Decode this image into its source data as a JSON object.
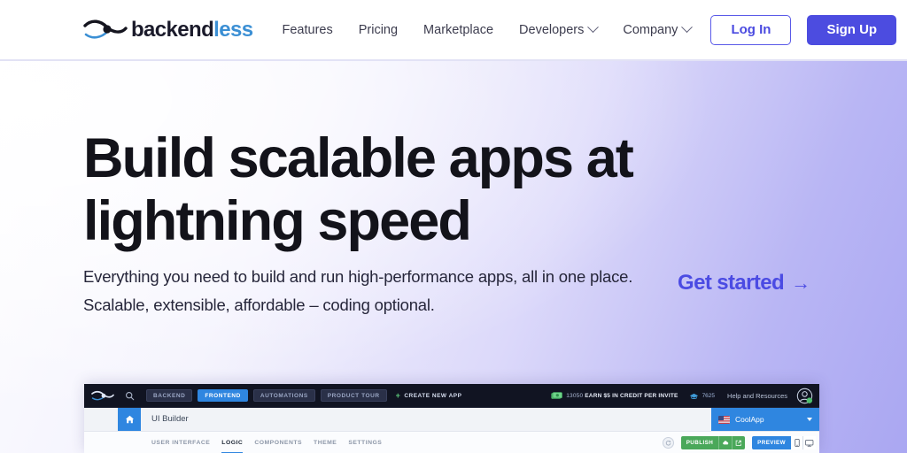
{
  "brand": {
    "name_dark": "backend",
    "name_blue": "less",
    "logo_icon": "backendless-infinity-logo",
    "blue": "#3b8fd4"
  },
  "nav": {
    "items": [
      {
        "label": "Features",
        "has_caret": false
      },
      {
        "label": "Pricing",
        "has_caret": false
      },
      {
        "label": "Marketplace",
        "has_caret": false
      },
      {
        "label": "Developers",
        "has_caret": true
      },
      {
        "label": "Company",
        "has_caret": true
      }
    ],
    "login_label": "Log In",
    "signup_label": "Sign Up",
    "accent": "#4c4ce0"
  },
  "hero": {
    "headline": "Build scalable apps at lightning speed",
    "subtext": "Everything you need to build and run high-performance apps, all in one place. Scalable, extensible, affordable – coding optional.",
    "cta_label": "Get started",
    "cta_arrow": "→",
    "cta_color": "#4b4be3"
  },
  "appshot": {
    "topbar": {
      "logo_icon": "backendless-mark-icon",
      "search_icon": "search-icon",
      "segments": [
        {
          "label": "BACKEND",
          "active": false
        },
        {
          "label": "FRONTEND",
          "active": true
        },
        {
          "label": "AUTOMATIONS",
          "active": false
        },
        {
          "label": "PRODUCT TOUR",
          "active": false
        }
      ],
      "create_new_app": "CREATE NEW APP",
      "credit_icon": "money-icon",
      "credit_count": "13050",
      "credit_text": "EARN $5 IN CREDIT PER INVITE",
      "cap_icon": "graduation-cap-icon",
      "cap_count": "7625",
      "help_label": "Help and Resources",
      "avatar_icon": "user-avatar-icon"
    },
    "row2": {
      "sidebar_icon": "analytics-chart-icon",
      "home_icon": "home-icon",
      "page_title": "UI Builder",
      "app_flag_icon": "us-flag-icon",
      "app_name": "CoolApp",
      "app_caret_icon": "chevron-down-icon"
    },
    "row3": {
      "tabs": [
        {
          "label": "USER INTERFACE",
          "active": false
        },
        {
          "label": "LOGIC",
          "active": true
        },
        {
          "label": "COMPONENTS",
          "active": false
        },
        {
          "label": "THEME",
          "active": false
        },
        {
          "label": "SETTINGS",
          "active": false
        }
      ],
      "round_icon": "refresh-icon",
      "publish_label": "PUBLISH",
      "publish_icons": [
        "cloud-icon",
        "external-link-icon"
      ],
      "publish_color": "#4aa85a",
      "preview_label": "PREVIEW",
      "preview_icons": [
        "mobile-icon",
        "desktop-icon"
      ],
      "preview_color": "#2f86e0"
    }
  }
}
